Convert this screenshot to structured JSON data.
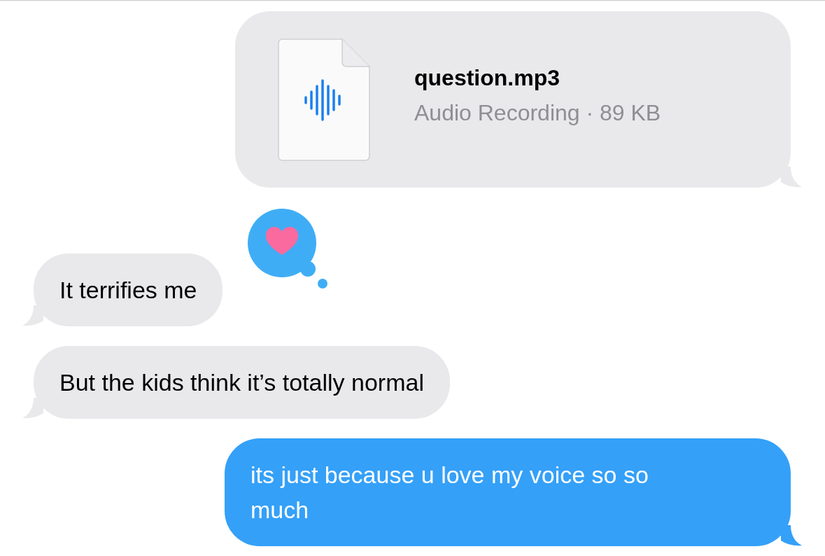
{
  "messages": [
    {
      "kind": "file",
      "outgoing": true,
      "file_name": "question.mp3",
      "file_info": "Audio Recording · 89 KB"
    },
    {
      "kind": "text",
      "outgoing": false,
      "text": "It terrifies me",
      "reaction": {
        "kind": "heart"
      }
    },
    {
      "kind": "text",
      "outgoing": false,
      "text": "But the kids think it’s totally normal"
    },
    {
      "kind": "text",
      "outgoing": true,
      "text": "its just because u love my voice so so much"
    }
  ]
}
